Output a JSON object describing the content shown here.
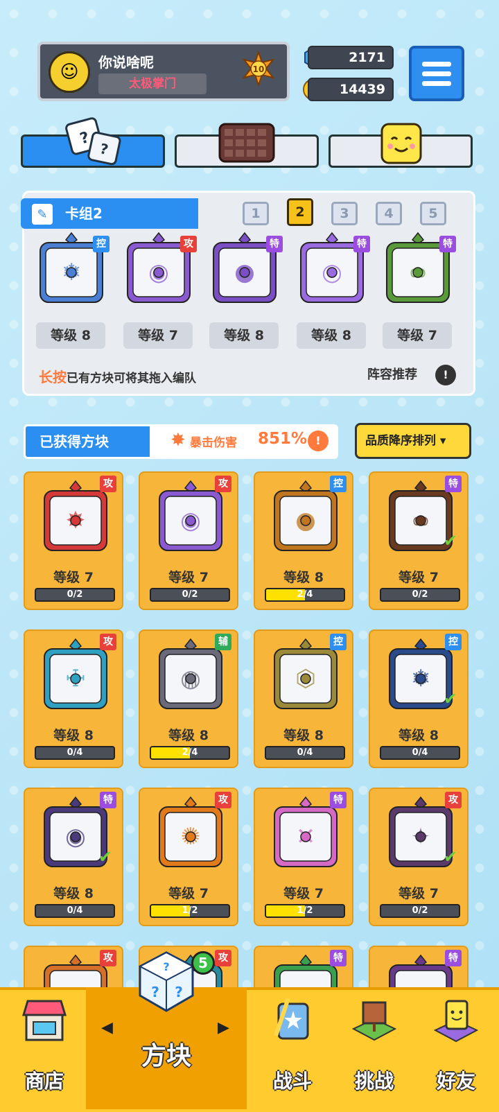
{
  "profile": {
    "name": "你说啥呢",
    "title": "太极掌门",
    "level": "10"
  },
  "currency": {
    "gems": "2171",
    "coins": "14439"
  },
  "deck": {
    "title": "卡组2",
    "tabs": [
      "1",
      "2",
      "3",
      "4",
      "5"
    ],
    "active_tab": "2",
    "cards": [
      {
        "type": "控",
        "level": "等级 8",
        "color": "#4a7fd4",
        "glyph": "❄"
      },
      {
        "type": "攻",
        "level": "等级 7",
        "color": "#8a5ad0",
        "glyph": "◉"
      },
      {
        "type": "特",
        "level": "等级 8",
        "color": "#7a4fc4",
        "glyph": "●"
      },
      {
        "type": "特",
        "level": "等级 8",
        "color": "#9a6ae0",
        "glyph": "◎"
      },
      {
        "type": "特",
        "level": "等级 7",
        "color": "#5b9a3a",
        "glyph": "∞"
      }
    ],
    "hint_highlight": "长按",
    "hint_text": "已有方块可将其拖入编队",
    "recommend": "阵容推荐"
  },
  "obtained": {
    "label": "已获得方块",
    "crit_label": "暴击伤害",
    "crit_value": "851%",
    "sort_label": "品质降序排列 ▾"
  },
  "grid": [
    {
      "type": "攻",
      "level": "等级 7",
      "progress": "0/2",
      "pct": 0,
      "color": "#d43a3a",
      "glyph": "✸",
      "check": false
    },
    {
      "type": "攻",
      "level": "等级 7",
      "progress": "0/2",
      "pct": 0,
      "color": "#8a5ad0",
      "glyph": "◉",
      "check": false
    },
    {
      "type": "控",
      "level": "等级 8",
      "progress": "2/4",
      "pct": 50,
      "color": "#c0761e",
      "glyph": "●",
      "check": false
    },
    {
      "type": "特",
      "level": "等级 7",
      "progress": "0/2",
      "pct": 0,
      "color": "#6a3a20",
      "glyph": "∞",
      "check": true
    },
    {
      "type": "攻",
      "level": "等级 8",
      "progress": "0/4",
      "pct": 0,
      "color": "#2fa0c0",
      "glyph": "☩",
      "check": false
    },
    {
      "type": "辅",
      "level": "等级 8",
      "progress": "2/4",
      "pct": 50,
      "color": "#6a6a7a",
      "glyph": "◍",
      "check": false
    },
    {
      "type": "控",
      "level": "等级 8",
      "progress": "0/4",
      "pct": 0,
      "color": "#9a8a3a",
      "glyph": "⬡",
      "check": false
    },
    {
      "type": "控",
      "level": "等级 8",
      "progress": "0/4",
      "pct": 0,
      "color": "#2a4a8a",
      "glyph": "❄",
      "check": true
    },
    {
      "type": "特",
      "level": "等级 8",
      "progress": "0/4",
      "pct": 0,
      "color": "#4a3a7a",
      "glyph": "◉",
      "check": true
    },
    {
      "type": "攻",
      "level": "等级 7",
      "progress": "1/2",
      "pct": 50,
      "color": "#e07a1a",
      "glyph": "✺",
      "check": false
    },
    {
      "type": "特",
      "level": "等级 7",
      "progress": "1/2",
      "pct": 50,
      "color": "#d46ac4",
      "glyph": "✕",
      "check": false
    },
    {
      "type": "攻",
      "level": "等级 7",
      "progress": "0/2",
      "pct": 0,
      "color": "#5a3a6a",
      "glyph": "✦",
      "check": true
    },
    {
      "type": "攻",
      "level": "",
      "progress": "",
      "pct": 0,
      "color": "#d4702a",
      "glyph": "●",
      "check": false
    },
    {
      "type": "攻",
      "level": "",
      "progress": "",
      "pct": 0,
      "color": "#2a8aa0",
      "glyph": "●",
      "check": false
    },
    {
      "type": "特",
      "level": "",
      "progress": "",
      "pct": 0,
      "color": "#3aa050",
      "glyph": "●",
      "check": false
    },
    {
      "type": "特",
      "level": "",
      "progress": "",
      "pct": 0,
      "color": "#6a3a8a",
      "glyph": "●",
      "check": false
    }
  ],
  "nav": {
    "shop": "商店",
    "blocks": "方块",
    "battle": "战斗",
    "challenge": "挑战",
    "friends": "好友",
    "badge": "5"
  },
  "type_colors": {
    "攻": "#e8403a",
    "控": "#2f8ff0",
    "特": "#9b4de0",
    "辅": "#2eaa5a"
  }
}
